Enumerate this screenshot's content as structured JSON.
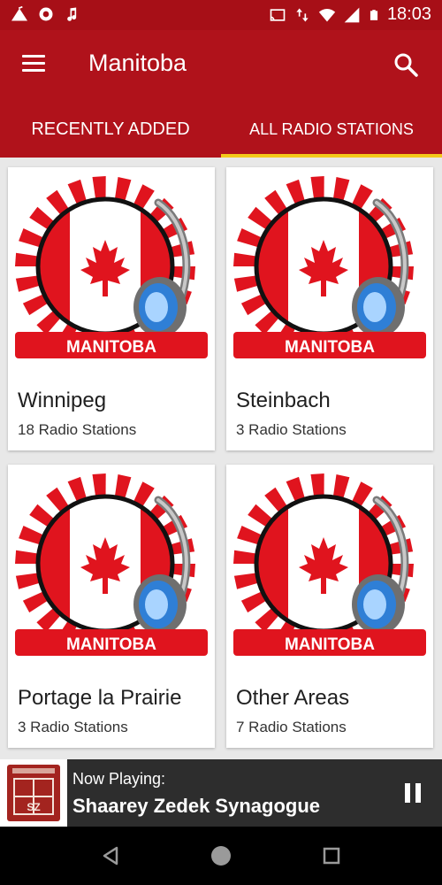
{
  "status_bar": {
    "time": "18:03",
    "left_icons": [
      "camp-icon",
      "aperture-icon",
      "music-note-icon"
    ],
    "right_icons": [
      "cast-icon",
      "data-arrows-icon",
      "wifi-icon",
      "signal-icon",
      "battery-icon"
    ]
  },
  "app_bar": {
    "title": "Manitoba",
    "menu_icon": "hamburger-menu-icon",
    "search_icon": "search-icon"
  },
  "tabs": [
    {
      "label": "RECENTLY ADDED",
      "selected": false
    },
    {
      "label": "ALL RADIO STATIONS",
      "selected": true
    }
  ],
  "cards": [
    {
      "title": "Winnipeg",
      "subtitle": "18 Radio Stations",
      "badge": "MANITOBA"
    },
    {
      "title": "Steinbach",
      "subtitle": "3 Radio Stations",
      "badge": "MANITOBA"
    },
    {
      "title": "Portage la Prairie",
      "subtitle": "3 Radio Stations",
      "badge": "MANITOBA"
    },
    {
      "title": "Other Areas",
      "subtitle": "7 Radio Stations",
      "badge": "MANITOBA"
    }
  ],
  "now_playing": {
    "label": "Now Playing:",
    "title": "Shaarey Zedek Synagogue",
    "thumb_text": "SZ",
    "control_icon": "pause-icon"
  },
  "nav_bar": {
    "icons": [
      "back-icon",
      "home-icon",
      "recents-icon"
    ]
  },
  "colors": {
    "app_bar": "#b0121b",
    "status_bar": "#a70f17",
    "tab_indicator": "#f3c91a",
    "now_playing_bg": "#2d2d2d",
    "badge_red": "#e0141e"
  }
}
